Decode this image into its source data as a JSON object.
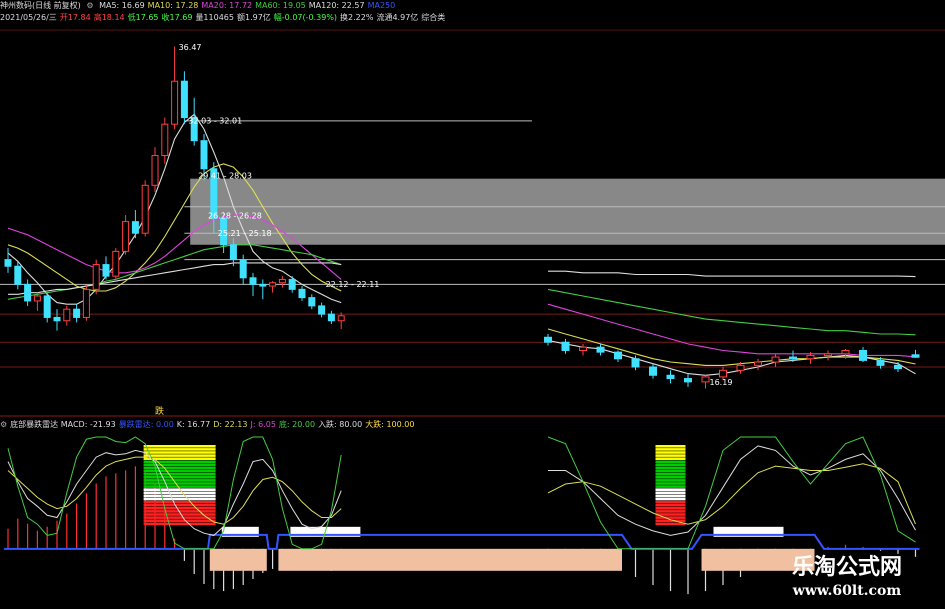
{
  "header": {
    "title": "神州数码(日线 前复权)",
    "ma_items": [
      {
        "label": "MA5: 16.69",
        "color": "#dddddd"
      },
      {
        "label": "MA10: 17.28",
        "color": "#dddd55"
      },
      {
        "label": "MA20: 17.72",
        "color": "#dd44dd"
      },
      {
        "label": "MA60: 19.05",
        "color": "#44cc44"
      },
      {
        "label": "MA120: 22.57",
        "color": "#dddddd"
      },
      {
        "label": "MA250",
        "color": "#3355ff"
      }
    ],
    "info_items": [
      {
        "label": "2021/05/26/三",
        "color": "#dddddd"
      },
      {
        "label": "开17.84",
        "color": "#ff4444"
      },
      {
        "label": "高18.14",
        "color": "#ff4444"
      },
      {
        "label": "低17.65",
        "color": "#44ff44"
      },
      {
        "label": "收17.69",
        "color": "#44ff44"
      },
      {
        "label": "量110465",
        "color": "#dddddd"
      },
      {
        "label": "额1.97亿",
        "color": "#dddddd"
      },
      {
        "label": "幅-0.07(-0.39%)",
        "color": "#44ff44"
      },
      {
        "label": "换2.22%",
        "color": "#dddddd"
      },
      {
        "label": "流通4.97亿",
        "color": "#dddddd"
      },
      {
        "label": "综合类",
        "color": "#dddddd"
      }
    ]
  },
  "indicator": {
    "items": [
      {
        "label": "底部暴跌雷达 MACD: -21.93",
        "color": "#dddddd"
      },
      {
        "label": "暴跌雷达: 0.00",
        "color": "#3355ff"
      },
      {
        "label": "K: 16.77",
        "color": "#dddddd"
      },
      {
        "label": "D: 22.13",
        "color": "#dddd55"
      },
      {
        "label": "J: 6.05",
        "color": "#dd44dd"
      },
      {
        "label": "底: 20.00",
        "color": "#44cc44"
      },
      {
        "label": "入跌: 80.00",
        "color": "#dddddd"
      },
      {
        "label": "大跌: 100.00",
        "color": "#ffdd44"
      }
    ],
    "tag": "跌"
  },
  "chart_data": {
    "type": "candlestick",
    "candles": [
      [
        23.6,
        24.3,
        22.8,
        23.2
      ],
      [
        23.2,
        23.5,
        21.8,
        22.1
      ],
      [
        22.1,
        22.4,
        20.8,
        21.1
      ],
      [
        21.1,
        21.6,
        20.5,
        21.4
      ],
      [
        21.4,
        21.6,
        19.8,
        20.1
      ],
      [
        20.1,
        20.6,
        19.3,
        19.9
      ],
      [
        19.9,
        20.8,
        19.6,
        20.6
      ],
      [
        20.6,
        20.9,
        19.8,
        20.1
      ],
      [
        20.1,
        22.0,
        19.9,
        21.8
      ],
      [
        21.8,
        23.6,
        21.5,
        23.3
      ],
      [
        23.3,
        23.8,
        22.4,
        22.6
      ],
      [
        22.6,
        24.3,
        22.4,
        24.1
      ],
      [
        24.1,
        26.3,
        23.9,
        25.9
      ],
      [
        25.9,
        26.6,
        24.9,
        25.2
      ],
      [
        25.2,
        28.4,
        25.0,
        28.1
      ],
      [
        28.1,
        30.4,
        27.7,
        29.9
      ],
      [
        29.9,
        32.2,
        29.4,
        31.8
      ],
      [
        31.8,
        36.5,
        31.5,
        34.4
      ],
      [
        34.4,
        35.0,
        31.8,
        32.2
      ],
      [
        32.2,
        33.4,
        30.5,
        30.8
      ],
      [
        30.8,
        31.2,
        28.4,
        29.1
      ],
      [
        29.1,
        29.5,
        25.2,
        26.1
      ],
      [
        26.1,
        26.5,
        24.0,
        24.5
      ],
      [
        24.5,
        24.9,
        23.2,
        23.6
      ],
      [
        23.6,
        23.9,
        22.1,
        22.5
      ],
      [
        22.5,
        22.8,
        21.4,
        22.1
      ],
      [
        22.1,
        22.4,
        21.2,
        22.0
      ],
      [
        22.0,
        22.3,
        21.6,
        22.2
      ],
      [
        22.2,
        22.6,
        21.9,
        22.4
      ],
      [
        22.4,
        22.6,
        21.6,
        21.8
      ],
      [
        21.8,
        22.0,
        21.1,
        21.3
      ],
      [
        21.3,
        21.5,
        20.6,
        20.8
      ],
      [
        20.8,
        21.0,
        20.1,
        20.3
      ],
      [
        20.3,
        20.5,
        19.7,
        19.9
      ],
      [
        19.9,
        20.4,
        19.4,
        20.2
      ],
      [
        18.9,
        19.1,
        18.4,
        18.6
      ],
      [
        18.6,
        18.8,
        17.9,
        18.1
      ],
      [
        18.1,
        18.5,
        17.8,
        18.3
      ],
      [
        18.3,
        18.5,
        17.8,
        18.0
      ],
      [
        18.0,
        18.1,
        17.4,
        17.6
      ],
      [
        17.6,
        17.8,
        16.9,
        17.1
      ],
      [
        17.1,
        17.3,
        16.4,
        16.6
      ],
      [
        16.6,
        16.9,
        16.1,
        16.4
      ],
      [
        16.4,
        16.7,
        15.9,
        16.2
      ],
      [
        16.2,
        16.6,
        15.8,
        16.5
      ],
      [
        16.5,
        17.1,
        16.3,
        16.9
      ],
      [
        16.9,
        17.4,
        16.7,
        17.2
      ],
      [
        17.2,
        17.6,
        16.9,
        17.4
      ],
      [
        17.4,
        17.9,
        17.1,
        17.7
      ],
      [
        17.7,
        18.1,
        17.4,
        17.6
      ],
      [
        17.6,
        18.0,
        17.3,
        17.8
      ],
      [
        17.8,
        18.1,
        17.5,
        17.9
      ],
      [
        17.9,
        18.2,
        17.6,
        18.1
      ],
      [
        18.1,
        18.3,
        17.4,
        17.5
      ],
      [
        17.5,
        17.7,
        17.0,
        17.2
      ],
      [
        17.2,
        17.4,
        16.8,
        17.0
      ],
      [
        17.84,
        18.14,
        17.65,
        17.69
      ]
    ],
    "segment_a_days": 35,
    "ma_lines": [
      {
        "name": "MA5",
        "color": "#dddddd",
        "values": [
          24.0,
          23.5,
          22.8,
          22.2,
          21.5,
          21.0,
          20.9,
          20.9,
          21.2,
          21.8,
          22.6,
          23.3,
          24.2,
          25.1,
          26.2,
          27.5,
          29.1,
          30.9,
          31.9,
          32.4,
          31.5,
          30.1,
          28.6,
          26.8,
          25.4,
          24.1,
          23.5,
          23.1,
          22.9,
          22.5,
          22.1,
          21.8,
          21.5,
          21.2,
          21.0,
          18.7,
          18.5,
          18.3,
          18.2,
          17.9,
          17.6,
          17.3,
          17.0,
          16.7,
          16.6,
          16.7,
          16.9,
          17.1,
          17.4,
          17.5,
          17.6,
          17.7,
          17.8,
          17.7,
          17.5,
          17.3,
          16.69
        ]
      },
      {
        "name": "MA10",
        "color": "#dddd55",
        "values": [
          24.5,
          24.3,
          24.0,
          23.6,
          23.2,
          22.8,
          22.4,
          22.0,
          21.8,
          21.7,
          21.7,
          21.9,
          22.3,
          22.8,
          23.4,
          24.1,
          25.0,
          26.0,
          27.0,
          28.0,
          28.8,
          29.2,
          29.4,
          29.2,
          28.6,
          27.8,
          26.8,
          25.8,
          24.9,
          24.0,
          23.3,
          22.7,
          22.3,
          22.0,
          21.7,
          19.4,
          19.1,
          18.8,
          18.5,
          18.2,
          17.9,
          17.6,
          17.4,
          17.3,
          17.2,
          17.2,
          17.3,
          17.4,
          17.5,
          17.6,
          17.6,
          17.7,
          17.7,
          17.7,
          17.6,
          17.5,
          17.28
        ]
      },
      {
        "name": "MA20",
        "color": "#dd44dd",
        "values": [
          25.5,
          25.3,
          25.1,
          24.8,
          24.5,
          24.2,
          23.9,
          23.6,
          23.3,
          23.1,
          22.9,
          22.8,
          22.8,
          22.9,
          23.1,
          23.4,
          23.8,
          24.3,
          24.8,
          25.3,
          25.7,
          26.0,
          26.2,
          26.3,
          26.3,
          26.2,
          26.0,
          25.7,
          25.3,
          24.9,
          24.4,
          23.9,
          23.4,
          22.9,
          22.4,
          20.9,
          20.6,
          20.3,
          20.0,
          19.7,
          19.4,
          19.1,
          18.8,
          18.5,
          18.3,
          18.1,
          18.0,
          17.9,
          17.9,
          17.9,
          17.9,
          17.9,
          17.9,
          17.8,
          17.8,
          17.8,
          17.72
        ]
      },
      {
        "name": "MA60",
        "color": "#44cc44",
        "values": [
          21.2,
          21.3,
          21.4,
          21.5,
          21.6,
          21.7,
          21.8,
          21.9,
          22.0,
          22.1,
          22.3,
          22.4,
          22.6,
          22.8,
          23.0,
          23.2,
          23.4,
          23.6,
          23.8,
          24.0,
          24.2,
          24.3,
          24.4,
          24.5,
          24.5,
          24.5,
          24.4,
          24.3,
          24.2,
          24.1,
          24.0,
          23.9,
          23.7,
          23.5,
          23.3,
          21.8,
          21.6,
          21.4,
          21.2,
          21.0,
          20.8,
          20.6,
          20.4,
          20.2,
          20.0,
          19.9,
          19.8,
          19.7,
          19.6,
          19.5,
          19.4,
          19.3,
          19.3,
          19.2,
          19.1,
          19.1,
          19.05
        ]
      },
      {
        "name": "MA120",
        "color": "#dddddd",
        "values": [
          21.5,
          21.5,
          21.6,
          21.6,
          21.7,
          21.8,
          21.8,
          21.9,
          22.0,
          22.1,
          22.2,
          22.3,
          22.4,
          22.5,
          22.6,
          22.7,
          22.8,
          22.9,
          23.0,
          23.1,
          23.2,
          23.3,
          23.3,
          23.4,
          23.4,
          23.4,
          23.4,
          23.4,
          23.4,
          23.4,
          23.4,
          23.4,
          23.4,
          23.4,
          23.3,
          22.9,
          22.9,
          22.8,
          22.8,
          22.8,
          22.7,
          22.7,
          22.7,
          22.7,
          22.6,
          22.6,
          22.6,
          22.6,
          22.6,
          22.6,
          22.6,
          22.6,
          22.6,
          22.6,
          22.6,
          22.6,
          22.57
        ]
      }
    ],
    "price_labels": [
      {
        "text": "36.47",
        "price": 36.47,
        "day": 17
      },
      {
        "text": "32.03 - 32.01",
        "price": 32.02,
        "day": 18
      },
      {
        "text": "29.41 - 28.03",
        "price": 28.7,
        "day": 19
      },
      {
        "text": "26.28 - 26.28",
        "price": 26.28,
        "day": 20
      },
      {
        "text": "25.21 - 25.18",
        "price": 25.2,
        "day": 21
      },
      {
        "text": "22.12 - 22.11",
        "price": 22.12,
        "day": 32
      },
      {
        "text": "16.19",
        "price": 16.19,
        "day": 44
      }
    ],
    "gray_zone": {
      "from_price": 24.5,
      "to_price": 28.5,
      "from_day": 19
    },
    "hlines": [
      32.0,
      26.8,
      25.2,
      23.6,
      22.1,
      20.3,
      18.6,
      17.1
    ],
    "indicator_series": [
      {
        "name": "K",
        "color": "#dddddd",
        "values": [
          78,
          60,
          45,
          38,
          30,
          28,
          42,
          58,
          70,
          82,
          86,
          84,
          85,
          88,
          86,
          78,
          60,
          40,
          26,
          18,
          14,
          12,
          20,
          40,
          58,
          78,
          80,
          70,
          52,
          36,
          22,
          18,
          20,
          30,
          52,
          70,
          70,
          60,
          45,
          30,
          22,
          16,
          12,
          15,
          30,
          55,
          80,
          92,
          88,
          74,
          66,
          72,
          80,
          85,
          70,
          45,
          16.77
        ]
      },
      {
        "name": "D",
        "color": "#dddd55",
        "values": [
          70,
          62,
          54,
          46,
          40,
          36,
          38,
          45,
          55,
          66,
          74,
          78,
          80,
          82,
          82,
          80,
          72,
          60,
          48,
          38,
          30,
          24,
          22,
          28,
          38,
          52,
          62,
          64,
          60,
          52,
          42,
          34,
          28,
          28,
          36,
          50,
          58,
          60,
          56,
          48,
          40,
          32,
          26,
          22,
          26,
          38,
          54,
          68,
          74,
          72,
          70,
          70,
          73,
          76,
          72,
          60,
          22.13
        ]
      },
      {
        "name": "J",
        "color": "#44cc44",
        "values": [
          90,
          56,
          28,
          22,
          12,
          14,
          50,
          82,
          98,
          100,
          100,
          96,
          95,
          100,
          94,
          74,
          36,
          5,
          0,
          0,
          0,
          0,
          16,
          62,
          96,
          100,
          100,
          80,
          36,
          4,
          0,
          0,
          4,
          34,
          84,
          100,
          94,
          60,
          24,
          0,
          0,
          0,
          0,
          0,
          38,
          88,
          100,
          100,
          100,
          78,
          58,
          76,
          94,
          100,
          66,
          16,
          6.05
        ]
      }
    ],
    "macd_values": [
      0.2,
      0.3,
      0.25,
      0.18,
      0.22,
      0.28,
      0.35,
      0.45,
      0.55,
      0.65,
      0.72,
      0.75,
      0.78,
      0.82,
      0.78,
      0.65,
      0.4,
      0.1,
      -0.12,
      -0.25,
      -0.35,
      -0.4,
      -0.42,
      -0.4,
      -0.36,
      -0.3,
      -0.24,
      -0.2,
      -0.15,
      -0.1,
      -0.08,
      -0.12,
      -0.18,
      -0.22,
      -0.2,
      -0.1,
      -0.08,
      -0.12,
      -0.16,
      -0.2,
      -0.28,
      -0.36,
      -0.42,
      -0.45,
      -0.42,
      -0.36,
      -0.28,
      -0.2,
      -0.12,
      -0.08,
      -0.04,
      0.02,
      0.04,
      0.02,
      -0.02,
      -0.05,
      -0.08
    ],
    "radar": [
      0,
      0,
      0,
      0,
      0,
      0,
      0,
      0,
      0,
      0,
      0,
      0,
      0,
      0,
      0,
      0,
      0,
      0,
      0,
      0,
      0,
      1,
      1,
      1,
      1,
      1,
      1,
      0,
      1,
      1,
      1,
      1,
      1,
      1,
      1,
      1,
      1,
      1,
      1,
      1,
      0,
      0,
      0,
      0,
      1,
      1,
      1,
      1,
      1,
      1,
      1,
      0,
      0,
      0,
      0,
      0,
      0
    ],
    "ylim": [
      14.8,
      37.5
    ],
    "ind_ylim": [
      -10,
      100
    ]
  },
  "watermark": {
    "cn": "乐淘公式网",
    "url": "www.60lt.com"
  }
}
